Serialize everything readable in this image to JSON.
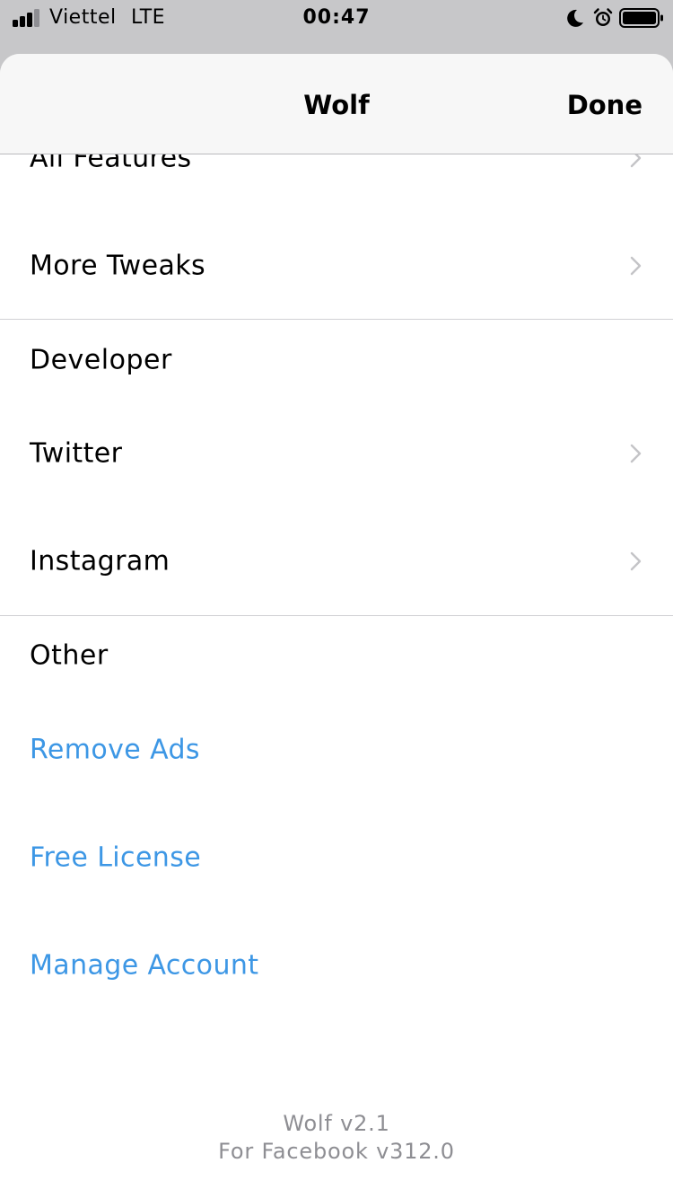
{
  "status_bar": {
    "carrier": "Viettel",
    "network": "LTE",
    "time": "00:47",
    "icons": [
      "signal-icon",
      "moon-icon",
      "alarm-icon",
      "battery-icon"
    ]
  },
  "nav": {
    "title": "Wolf",
    "done_label": "Done"
  },
  "rows": {
    "all_features": "All Features",
    "more_tweaks": "More Tweaks",
    "developer_header": "Developer",
    "twitter": "Twitter",
    "instagram": "Instagram",
    "other_header": "Other",
    "remove_ads": "Remove Ads",
    "free_license": "Free License",
    "manage_account": "Manage Account"
  },
  "footer": {
    "line1": "Wolf v2.1",
    "line2": "For Facebook v312.0"
  },
  "colors": {
    "link": "#3d97e5",
    "chevron": "#c4c4c7",
    "footer_text": "#8e8e93"
  }
}
